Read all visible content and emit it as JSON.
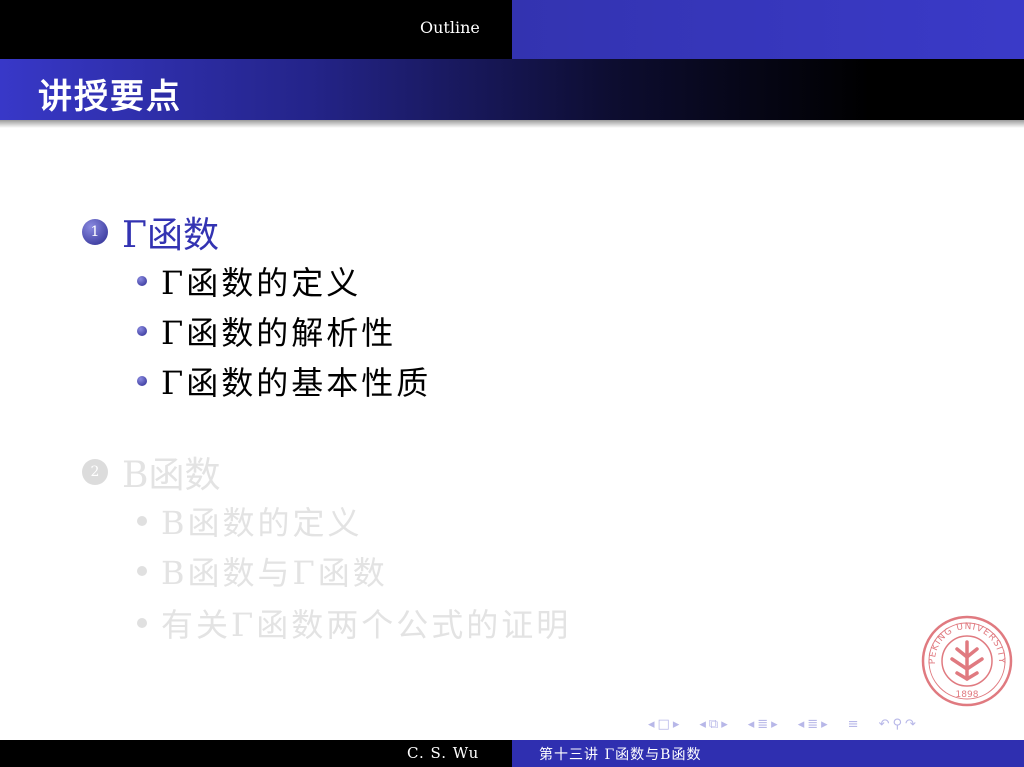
{
  "header": {
    "section_nav": "Outline"
  },
  "frame": {
    "title": "讲授要点"
  },
  "outline": {
    "sections": [
      {
        "number": "1",
        "label": "Γ函数",
        "state": "active",
        "items": [
          "Γ函数的定义",
          "Γ函数的解析性",
          "Γ函数的基本性质"
        ]
      },
      {
        "number": "2",
        "label": "B函数",
        "state": "inactive",
        "items": [
          "B函数的定义",
          "B函数与Γ函数",
          "有关Γ函数两个公式的证明"
        ]
      }
    ]
  },
  "logo": {
    "text": "PEKING UNIVERSITY",
    "year": "1898"
  },
  "navigation": {
    "icons": [
      "frame-prev",
      "frame-next",
      "subsection-prev",
      "subsection-next",
      "section-prev",
      "section-next",
      "align",
      "search"
    ]
  },
  "footer": {
    "author": "C. S. Wu",
    "lecture": "第十三讲  Γ函数与B函数"
  },
  "colors": {
    "accent": "#3333b2",
    "footer_right": "#2f2fb0",
    "inactive_text": "#e3e3e3"
  }
}
